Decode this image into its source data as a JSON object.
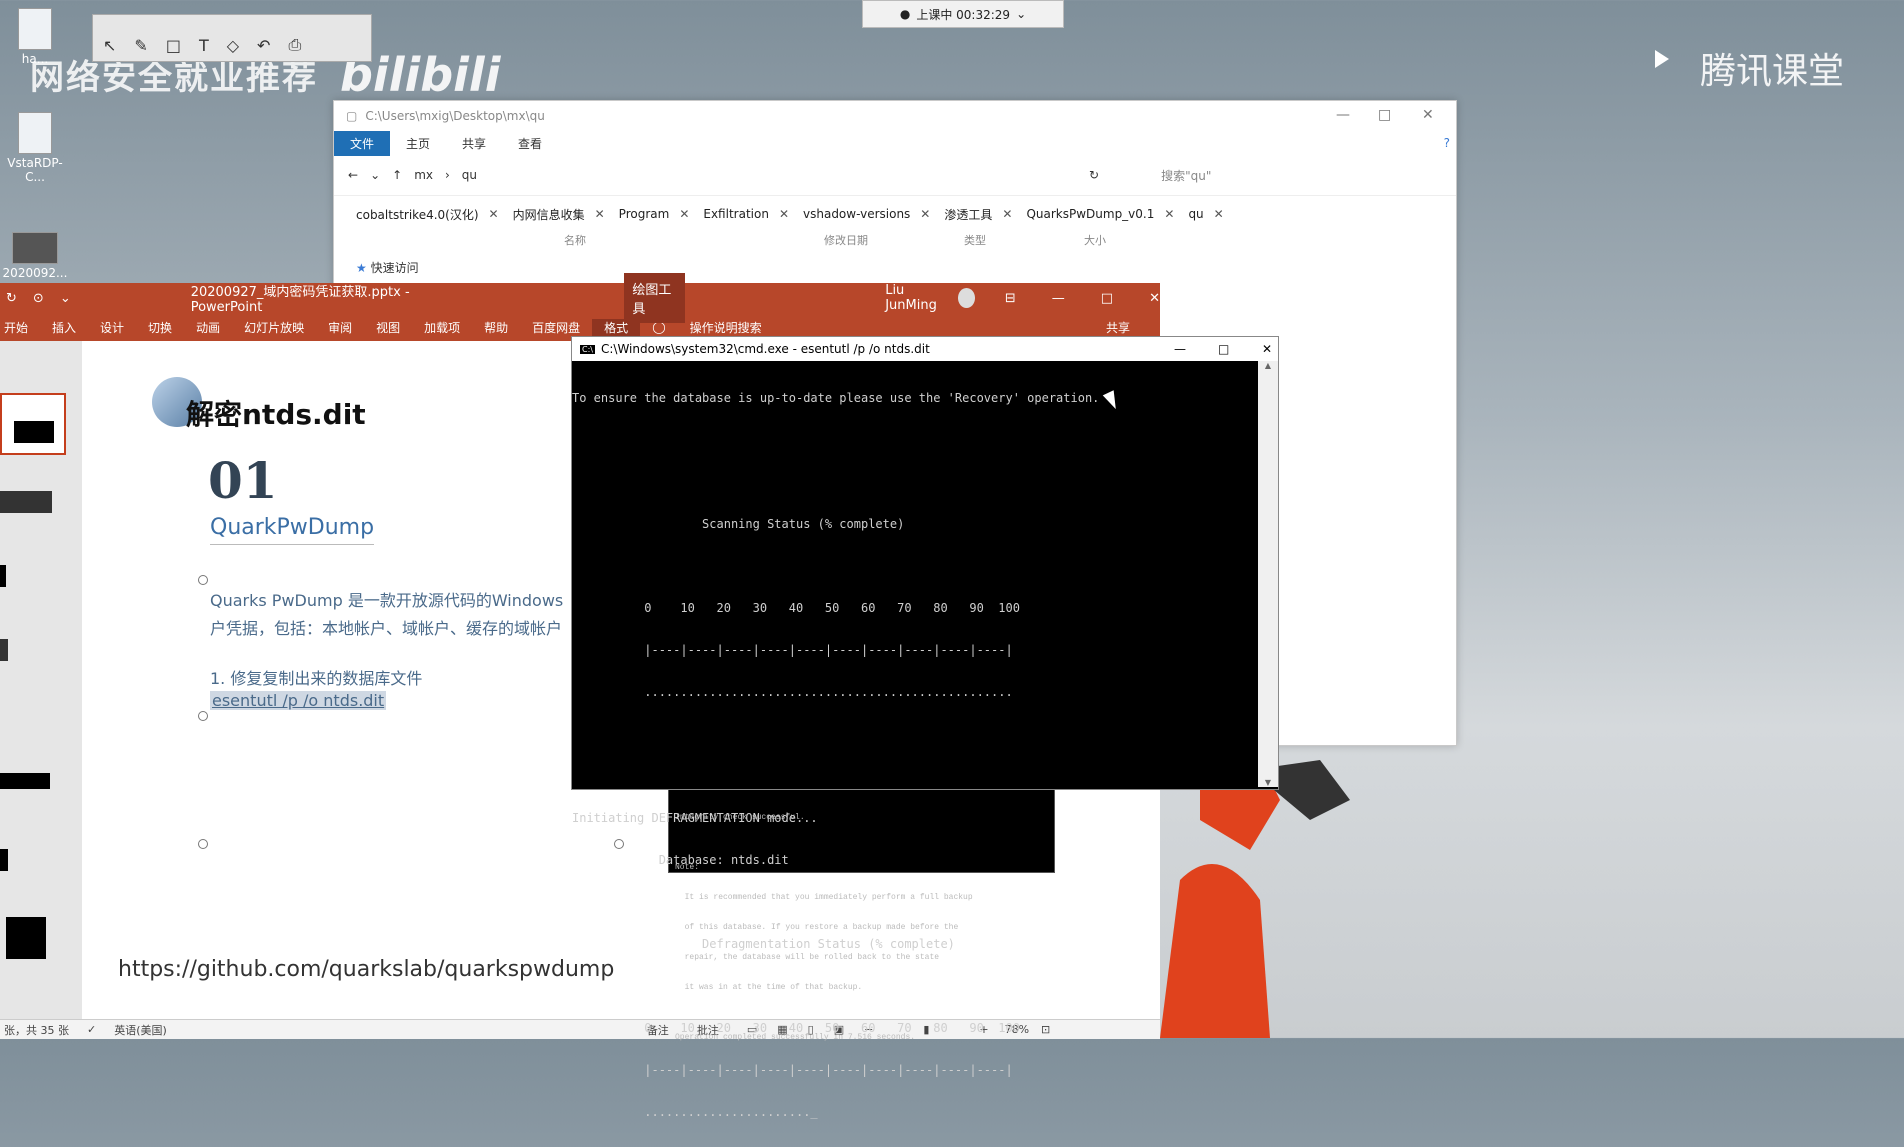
{
  "desktop": {
    "icons": [
      {
        "label": "ha..."
      },
      {
        "label": "VstaRDP-C..."
      },
      {
        "label": "2020092..."
      }
    ],
    "watermark": "网络安全就业推荐",
    "watermark_brand": "bilibili",
    "tencent": "腾讯课堂",
    "class_timer": "上课中 00:32:29"
  },
  "annotation_toolbar": [
    "↖",
    "✎",
    "□",
    "T",
    "◇",
    "↶",
    "⎙"
  ],
  "explorer": {
    "title": "C:\\Users\\mxig\\Desktop\\mx\\qu",
    "ribbon": [
      "文件",
      "主页",
      "共享",
      "查看"
    ],
    "path": [
      "mx",
      "qu"
    ],
    "search_placeholder": "搜索\"qu\"",
    "tabs": [
      "cobaltstrike4.0(汉化)",
      "内网信息收集",
      "Program",
      "Exfiltration",
      "vshadow-versions",
      "渗透工具",
      "QuarksPwDump_v0.1",
      "qu"
    ],
    "columns": [
      "名称",
      "修改日期",
      "类型",
      "大小"
    ],
    "sidebar": "快速访问"
  },
  "powerpoint": {
    "title": "20200927_域内密码凭证获取.pptx - PowerPoint",
    "tools": "绘图工具",
    "user": "Liu JunMing",
    "menu": [
      "开始",
      "插入",
      "设计",
      "切换",
      "动画",
      "幻灯片放映",
      "审阅",
      "视图",
      "加载项",
      "帮助",
      "百度网盘",
      "格式"
    ],
    "tell_me": "操作说明搜索",
    "share": "共享",
    "slide": {
      "heading": "解密ntds.dit",
      "number": "01",
      "subtitle": "QuarkPwDump",
      "desc1": "Quarks PwDump 是一款开放源代码的Windows",
      "desc2": "户凭据，包括：本地帐户、域帐户、缓存的域帐户",
      "step": "1. 修复复制出来的数据库文件",
      "command": "esentutl /p /o ntds.dit",
      "url": "https://github.com/quarkslab/quarkspwdump"
    },
    "status": {
      "slide": "张，共 35 张",
      "lang": "英语(美国)",
      "notes": "备注",
      "comments": "批注",
      "zoom": "78%"
    }
  },
  "cmd": {
    "title": "C:\\Windows\\system32\\cmd.exe - esentutl  /p /o ntds.dit",
    "lines": [
      "To ensure the database is up-to-date please use the 'Recovery' operation.",
      "",
      "",
      "                  Scanning Status (% complete)",
      "",
      "          0    10   20   30   40   50   60   70   80   90  100",
      "          |----|----|----|----|----|----|----|----|----|----|",
      "          ...................................................",
      "",
      "",
      "Initiating DEFRAGMENTATION mode...",
      "            Database: ntds.dit",
      "",
      "                  Defragmentation Status (% complete)",
      "",
      "          0    10   20   30   40   50   60   70   80   90  100",
      "          |----|----|----|----|----|----|----|----|----|----|",
      "          ......................._"
    ]
  },
  "cmd_behind": {
    "lines": [
      "Integrity check successful.",
      "",
      "Note:",
      "  It is recommended that you immediately perform a full backup",
      "  of this database. If you restore a backup made before the",
      "  repair, the database will be rolled back to the state",
      "  it was in at the time of that backup.",
      "",
      "Operation completed successfully in 7.516 seconds."
    ]
  }
}
